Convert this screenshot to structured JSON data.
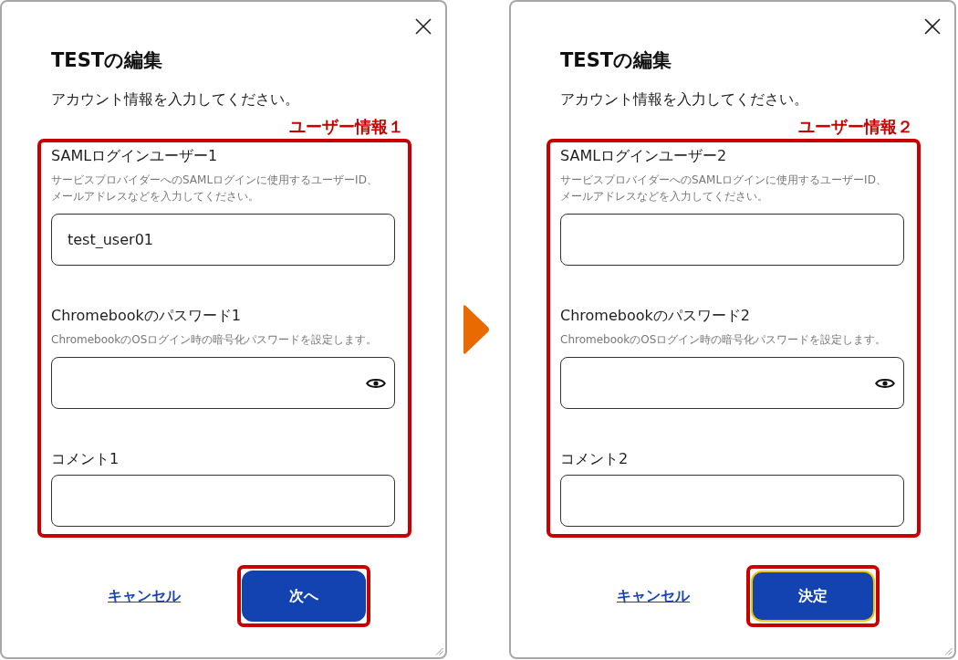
{
  "panels": [
    {
      "title": "TESTの編集",
      "subtitle": "アカウント情報を入力してください。",
      "annotation": {
        "label": "ユーザー情報１"
      },
      "fields": [
        {
          "kind": "text",
          "label": "SAMLログインユーザー1",
          "hint": "サービスプロバイダーへのSAMLログインに使用するユーザーID、メールアドレスなどを入力してください。",
          "value": "test_user01"
        },
        {
          "kind": "password",
          "label": "Chromebookのパスワード1",
          "hint": "ChromebookのOSログイン時の暗号化パスワードを設定します。"
        },
        {
          "kind": "text",
          "label": "コメント1"
        }
      ],
      "cancel_link": "キャンセル",
      "primary_button": {
        "label": "次へ",
        "highlighted": true,
        "focused": false
      }
    },
    {
      "title": "TESTの編集",
      "subtitle": "アカウント情報を入力してください。",
      "annotation": {
        "label": "ユーザー情報２"
      },
      "fields": [
        {
          "kind": "text",
          "label": "SAMLログインユーザー2",
          "hint": "サービスプロバイダーへのSAMLログインに使用するユーザーID、メールアドレスなどを入力してください。"
        },
        {
          "kind": "password",
          "label": "Chromebookのパスワード2",
          "hint": "ChromebookのOSログイン時の暗号化パスワードを設定します。"
        },
        {
          "kind": "text",
          "label": "コメント2"
        }
      ],
      "cancel_link": "キャンセル",
      "primary_button": {
        "label": "決定",
        "highlighted": true,
        "focused": true
      }
    }
  ]
}
